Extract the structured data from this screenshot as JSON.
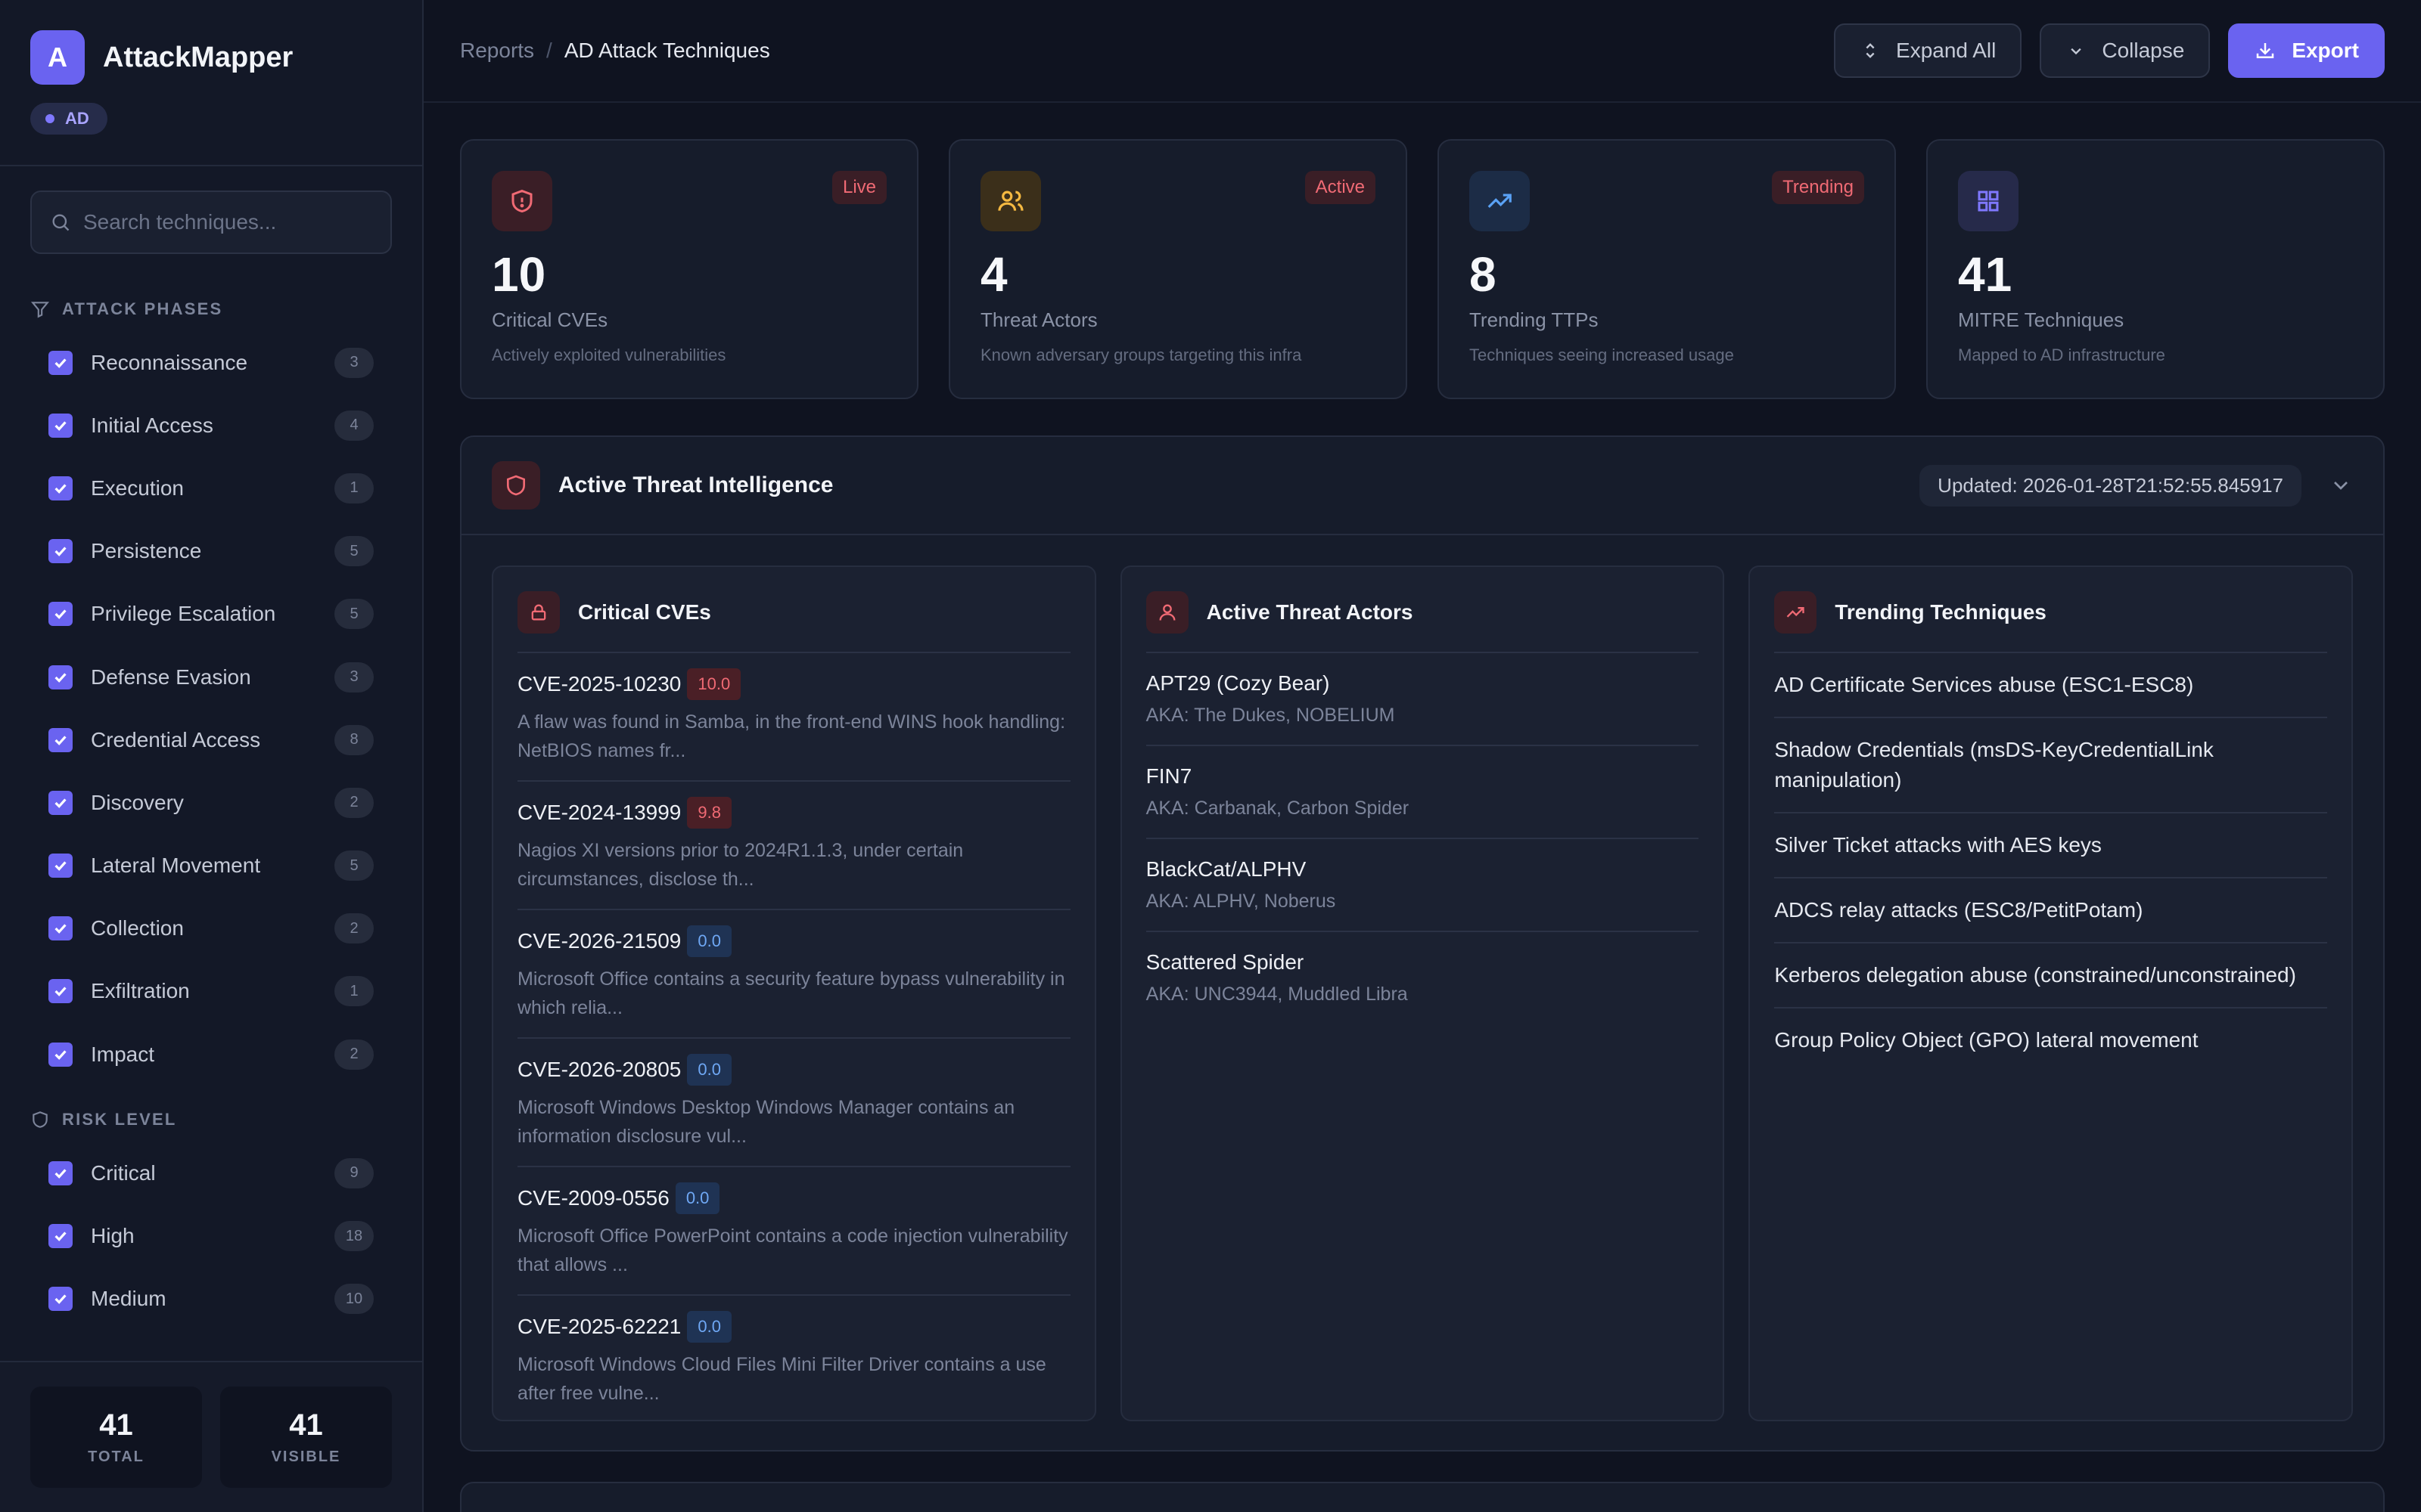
{
  "app": {
    "logo_letter": "A",
    "name": "AttackMapper",
    "env_badge": "AD"
  },
  "search": {
    "placeholder": "Search techniques..."
  },
  "filters": {
    "phases_title": "ATTACK PHASES",
    "phases": [
      {
        "label": "Reconnaissance",
        "count": "3"
      },
      {
        "label": "Initial Access",
        "count": "4"
      },
      {
        "label": "Execution",
        "count": "1"
      },
      {
        "label": "Persistence",
        "count": "5"
      },
      {
        "label": "Privilege Escalation",
        "count": "5"
      },
      {
        "label": "Defense Evasion",
        "count": "3"
      },
      {
        "label": "Credential Access",
        "count": "8"
      },
      {
        "label": "Discovery",
        "count": "2"
      },
      {
        "label": "Lateral Movement",
        "count": "5"
      },
      {
        "label": "Collection",
        "count": "2"
      },
      {
        "label": "Exfiltration",
        "count": "1"
      },
      {
        "label": "Impact",
        "count": "2"
      }
    ],
    "risk_title": "RISK LEVEL",
    "risks": [
      {
        "label": "Critical",
        "count": "9"
      },
      {
        "label": "High",
        "count": "18"
      },
      {
        "label": "Medium",
        "count": "10"
      }
    ]
  },
  "footer_stats": {
    "total_value": "41",
    "total_label": "TOTAL",
    "visible_value": "41",
    "visible_label": "VISIBLE"
  },
  "breadcrumb": {
    "parent": "Reports",
    "separator": "/",
    "current": "AD Attack Techniques"
  },
  "toolbar": {
    "expand_label": "Expand All",
    "collapse_label": "Collapse",
    "export_label": "Export"
  },
  "stats": [
    {
      "tag": "Live",
      "value": "10",
      "title": "Critical CVEs",
      "desc": "Actively exploited vulnerabilities",
      "icon": "shield-icon",
      "color": "#f06a74"
    },
    {
      "tag": "Active",
      "value": "4",
      "title": "Threat Actors",
      "desc": "Known adversary groups targeting this infra",
      "icon": "users-icon",
      "color": "#f5b941"
    },
    {
      "tag": "Trending",
      "value": "8",
      "title": "Trending TTPs",
      "desc": "Techniques seeing increased usage",
      "icon": "trend-icon",
      "color": "#5aa2f5"
    },
    {
      "tag": "",
      "value": "41",
      "title": "MITRE Techniques",
      "desc": "Mapped to AD infrastructure",
      "icon": "grid-icon",
      "color": "#7f78ff"
    }
  ],
  "intel": {
    "title": "Active Threat Intelligence",
    "updated": "Updated: 2026-01-28T21:52:55.845917",
    "cves_title": "Critical CVEs",
    "cves": [
      {
        "id": "CVE-2025-10230",
        "score": "10.0",
        "severity": "high",
        "desc": "A flaw was found in Samba, in the front-end WINS hook handling: NetBIOS names fr..."
      },
      {
        "id": "CVE-2024-13999",
        "score": "9.8",
        "severity": "high",
        "desc": "Nagios XI versions prior to 2024R1.1.3, under certain circumstances, disclose th..."
      },
      {
        "id": "CVE-2026-21509",
        "score": "0.0",
        "severity": "zero",
        "desc": "Microsoft Office contains a security feature bypass vulnerability in which relia..."
      },
      {
        "id": "CVE-2026-20805",
        "score": "0.0",
        "severity": "zero",
        "desc": "Microsoft Windows Desktop Windows Manager contains an information disclosure vul..."
      },
      {
        "id": "CVE-2009-0556",
        "score": "0.0",
        "severity": "zero",
        "desc": "Microsoft Office PowerPoint contains a code injection vulnerability that allows ..."
      },
      {
        "id": "CVE-2025-62221",
        "score": "0.0",
        "severity": "zero",
        "desc": "Microsoft Windows Cloud Files Mini Filter Driver contains a use after free vulne..."
      }
    ],
    "actors_title": "Active Threat Actors",
    "actors": [
      {
        "name": "APT29 (Cozy Bear)",
        "aka": "AKA: The Dukes, NOBELIUM"
      },
      {
        "name": "FIN7",
        "aka": "AKA: Carbanak, Carbon Spider"
      },
      {
        "name": "BlackCat/ALPHV",
        "aka": "AKA: ALPHV, Noberus"
      },
      {
        "name": "Scattered Spider",
        "aka": "AKA: UNC3944, Muddled Libra"
      }
    ],
    "techniques_title": "Trending Techniques",
    "techniques": [
      "AD Certificate Services abuse (ESC1-ESC8)",
      "Shadow Credentials (msDS-KeyCredentialLink manipulation)",
      "Silver Ticket attacks with AES keys",
      "ADCS relay attacks (ESC8/PetitPotam)",
      "Kerberos delegation abuse (constrained/unconstrained)",
      "Group Policy Object (GPO) lateral movement"
    ]
  }
}
